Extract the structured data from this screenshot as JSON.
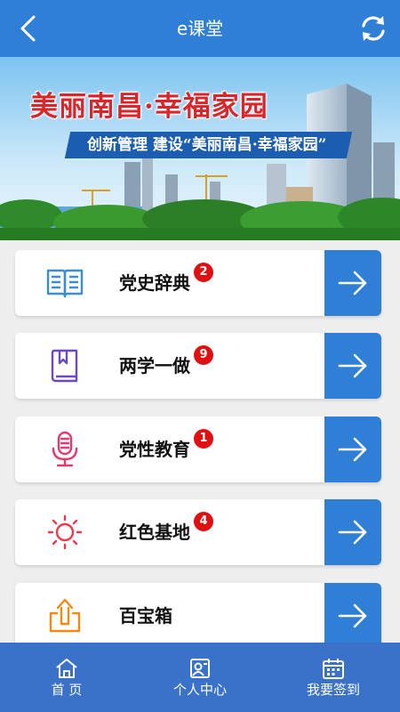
{
  "header": {
    "title": "e课堂",
    "back_icon": "chevron-left-icon",
    "refresh_icon": "refresh-icon",
    "background": "#2f7fd6"
  },
  "banner": {
    "title": "美丽南昌·幸福家园",
    "subtitle": "创新管理 建设“美丽南昌·幸福家园”",
    "slide_count": 5,
    "active_slide": 1
  },
  "menu": [
    {
      "label": "党史辞典",
      "badge": "2",
      "icon": "open-book-icon",
      "icon_color": "#3c8dd6"
    },
    {
      "label": "两学一做",
      "badge": "9",
      "icon": "bookmark-book-icon",
      "icon_color": "#6a48c8"
    },
    {
      "label": "党性教育",
      "badge": "1",
      "icon": "microphone-icon",
      "icon_color": "#e23a6e"
    },
    {
      "label": "红色基地",
      "badge": "4",
      "icon": "sun-icon",
      "icon_color": "#ea3a4c"
    },
    {
      "label": "百宝箱",
      "badge": "",
      "icon": "share-upload-icon",
      "icon_color": "#f08a10"
    }
  ],
  "bottom_nav": [
    {
      "label": "首 页",
      "icon": "home-icon"
    },
    {
      "label": "个人中心",
      "icon": "profile-card-icon"
    },
    {
      "label": "我要签到",
      "icon": "calendar-icon"
    }
  ],
  "colors": {
    "accent": "#2f7fd6",
    "badge": "#e01010",
    "tabbar": "#3a72c9"
  }
}
